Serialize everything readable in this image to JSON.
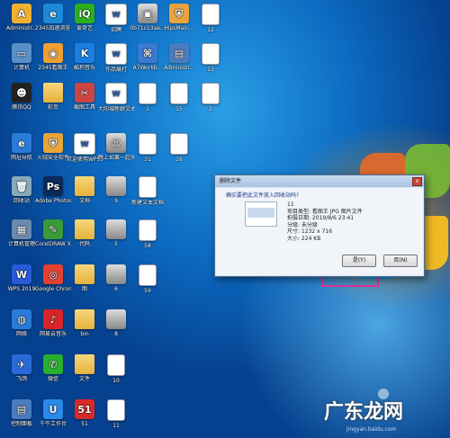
{
  "desktop": {
    "icons": [
      {
        "label": "Administr...",
        "glyph": "A",
        "color": "#f0b030"
      },
      {
        "label": "2345加速浏览器",
        "glyph": "e",
        "color": "#1c8ad8"
      },
      {
        "label": "爱奇艺",
        "glyph": "iQ",
        "color": "#2cb11b"
      },
      {
        "label": "招聘",
        "glyph": "W",
        "color": "doc"
      },
      {
        "label": "0b71c13ae...",
        "glyph": "▣",
        "color": "thumb"
      },
      {
        "label": "HipsMain...",
        "glyph": "⛨",
        "color": "#e8a53a"
      },
      {
        "label": "12",
        "glyph": "",
        "color": "small"
      },
      {
        "label": "计算机",
        "glyph": "▭",
        "color": "#5a8fc8"
      },
      {
        "label": "2345看图王",
        "glyph": "◉",
        "color": "#f0a030"
      },
      {
        "label": "酷狗音乐",
        "glyph": "K",
        "color": "#1a7fe0"
      },
      {
        "label": "作品展打",
        "glyph": "W",
        "color": "doc"
      },
      {
        "label": "A7Workb...",
        "glyph": "⌘",
        "color": "#3a7ad2"
      },
      {
        "label": "Administr...",
        "glyph": "▤",
        "color": "#4a7cc0"
      },
      {
        "label": "13",
        "glyph": "",
        "color": "small"
      },
      {
        "label": "腾讯QQ",
        "glyph": "☻",
        "color": "#222"
      },
      {
        "label": "彩页",
        "glyph": "",
        "color": "folder"
      },
      {
        "label": "截图工具",
        "glyph": "✂",
        "color": "#c44"
      },
      {
        "label": "大阳城新娘文本",
        "glyph": "W",
        "color": "doc"
      },
      {
        "label": "1",
        "glyph": "",
        "color": "small"
      },
      {
        "label": "15",
        "glyph": "",
        "color": "small"
      },
      {
        "label": "2",
        "glyph": "",
        "color": "small"
      },
      {
        "label": "网址导航",
        "glyph": "e",
        "color": "#2a7ad8"
      },
      {
        "label": "火绒安全软件",
        "glyph": "⛨",
        "color": "#e8a53a"
      },
      {
        "label": "欢迎使用WPS文字",
        "glyph": "W",
        "color": "doc"
      },
      {
        "label": "晚上如果一起来聊",
        "glyph": "☺",
        "color": "thumb"
      },
      {
        "label": "31",
        "glyph": "",
        "color": "small"
      },
      {
        "label": "16",
        "glyph": "",
        "color": "small"
      },
      {
        "label": "回收站",
        "glyph": "🗑",
        "color": "#8ab"
      },
      {
        "label": "Adobe Photosh...",
        "glyph": "Ps",
        "color": "#0a2a5a"
      },
      {
        "label": "文档",
        "glyph": "",
        "color": "folder"
      },
      {
        "label": "9",
        "glyph": "",
        "color": "thumb"
      },
      {
        "label": "新建文本文档",
        "glyph": "",
        "color": "small"
      },
      {
        "label": "计算机管理",
        "glyph": "▦",
        "color": "#6a8ab0"
      },
      {
        "label": "CorelDRAW X7",
        "glyph": "✎",
        "color": "#3a9a3a"
      },
      {
        "label": "代码",
        "glyph": "",
        "color": "folder"
      },
      {
        "label": "5",
        "glyph": "",
        "color": "thumb"
      },
      {
        "label": "58",
        "glyph": "",
        "color": "small"
      },
      {
        "label": "WPS 2019",
        "glyph": "W",
        "color": "#2a5ad8"
      },
      {
        "label": "Google Chrome",
        "glyph": "◎",
        "color": "#e34133"
      },
      {
        "label": "图",
        "glyph": "",
        "color": "folder"
      },
      {
        "label": "6",
        "glyph": "",
        "color": "thumb"
      },
      {
        "label": "59",
        "glyph": "",
        "color": "small"
      },
      {
        "label": "网络",
        "glyph": "◍",
        "color": "#2a7ad8"
      },
      {
        "label": "网易云音乐",
        "glyph": "♪",
        "color": "#d8252a"
      },
      {
        "label": "bin",
        "glyph": "",
        "color": "folder"
      },
      {
        "label": "8",
        "glyph": "",
        "color": "thumb"
      },
      {
        "label": "飞鸽",
        "glyph": "✈",
        "color": "#2a6ad8"
      },
      {
        "label": "微信",
        "glyph": "✆",
        "color": "#28b02e"
      },
      {
        "label": "文件",
        "glyph": "",
        "color": "folder"
      },
      {
        "label": "10",
        "glyph": "",
        "color": "small"
      },
      {
        "label": "控制面板",
        "glyph": "▤",
        "color": "#4a7cc0"
      },
      {
        "label": "千牛工作台",
        "glyph": "U",
        "color": "#2a8ae8"
      },
      {
        "label": "51",
        "glyph": "51",
        "color": "#d82a2a"
      },
      {
        "label": "11",
        "glyph": "",
        "color": "small"
      }
    ]
  },
  "dialog": {
    "title": "删除文件",
    "close_label": "x",
    "question": "确实要把此文件放入回收站吗?",
    "file": {
      "name": "11",
      "type": "项目类型: 看图王 JPG 图片文件",
      "date": "拍摄日期: 2019/8/6 23:41",
      "rating": "分级: 未分级",
      "dimensions": "尺寸: 1232 x 716",
      "size": "大小: 224 KB"
    },
    "yes_label": "是(Y)",
    "no_label": "否(N)"
  },
  "watermark": {
    "brand": "广东龙网",
    "suffix": "om",
    "site": "jingyan.baidu.com"
  },
  "colors": {
    "highlight": "#e0309a",
    "accent": "#0c6bc2"
  }
}
